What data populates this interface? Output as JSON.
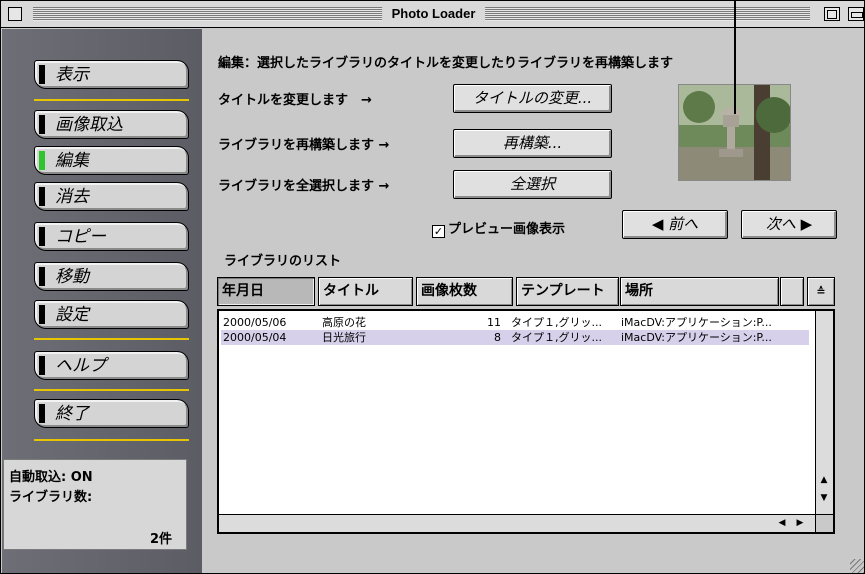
{
  "window": {
    "title": "Photo Loader"
  },
  "sidebar": {
    "items": [
      {
        "label": "表示",
        "active": false
      },
      {
        "label": "画像取込",
        "active": false
      },
      {
        "label": "編集",
        "active": true
      },
      {
        "label": "消去",
        "active": false
      },
      {
        "label": "コピー",
        "active": false
      },
      {
        "label": "移動",
        "active": false
      },
      {
        "label": "設定",
        "active": false
      },
      {
        "label": "ヘルプ",
        "active": false
      },
      {
        "label": "終了",
        "active": false
      }
    ],
    "status": {
      "auto_import": "自動取込: ON",
      "library_count_label": "ライブラリ数:",
      "library_count_value": "2件"
    }
  },
  "main": {
    "description": "編集：選択したライブラリのタイトルを変更したりライブラリを再構築します",
    "actions": [
      {
        "text": "タイトルを変更します　→",
        "button": "タイトルの変更..."
      },
      {
        "text": "ライブラリを再構築します →",
        "button": "再構築..."
      },
      {
        "text": "ライブラリを全選択します →",
        "button": "全選択"
      }
    ],
    "preview_checkbox": {
      "label": "プレビュー画像表示",
      "checked": true,
      "mark": "✓"
    },
    "nav": {
      "prev": "◀ 前へ",
      "next": "次へ ▶"
    },
    "list_title": "ライブラリのリスト",
    "columns": [
      "年月日",
      "タイトル",
      "画像枚数",
      "テンプレート",
      "場所",
      "",
      "≙"
    ],
    "rows": [
      {
        "date": "2000/05/06",
        "title": "高原の花",
        "count": "11",
        "template": "タイプ１,グリッ...",
        "location": "iMacDV:アプリケーション:P...",
        "selected": false
      },
      {
        "date": "2000/05/04",
        "title": "日光旅行",
        "count": "8",
        "template": "タイプ１,グリッ...",
        "location": "iMacDV:アプリケーション:P...",
        "selected": true
      }
    ],
    "scroll": {
      "up": "▲",
      "down": "▼",
      "left": "◀",
      "right": "▶"
    }
  },
  "colors": {
    "sidebar_bg": "#65656d",
    "active_led": "#2ec52e",
    "divider": "#e6c400",
    "selected_row": "#d6d0ea"
  }
}
